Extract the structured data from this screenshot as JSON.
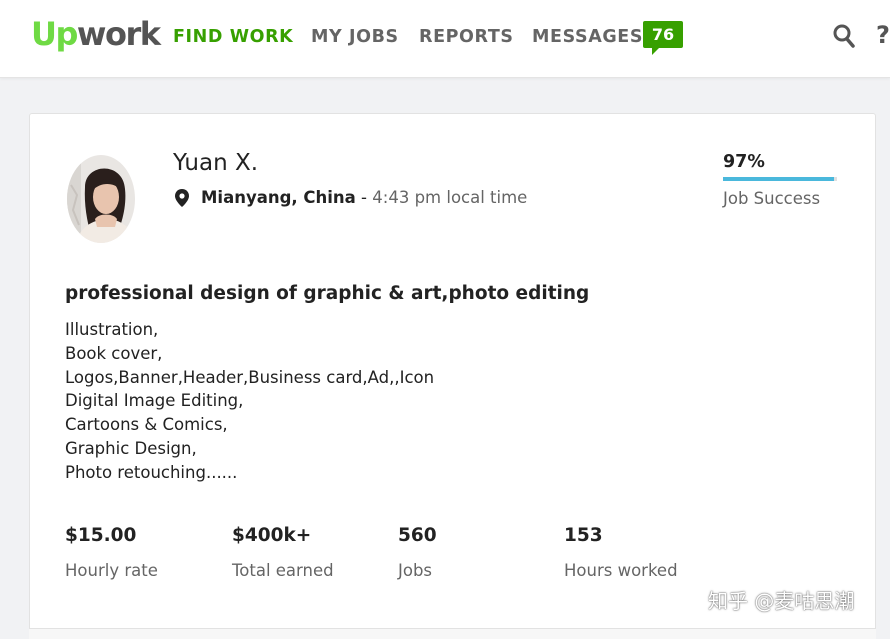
{
  "header": {
    "logo": {
      "up": "Up",
      "work": "work"
    },
    "nav": [
      {
        "label": "FIND WORK",
        "active": true
      },
      {
        "label": "MY JOBS",
        "active": false
      },
      {
        "label": "REPORTS",
        "active": false
      },
      {
        "label": "MESSAGES",
        "active": false
      }
    ],
    "messages_count": "76",
    "search_icon": "search-icon",
    "help_label": "?"
  },
  "profile": {
    "name": "Yuan X.",
    "location_city": "Mianyang, China",
    "location_separator": " - ",
    "local_time": "4:43 pm local time",
    "job_success": {
      "percent_label": "97%",
      "value": 0.97,
      "label": "Job Success"
    },
    "headline": "professional design of graphic & art,photo editing",
    "description_lines": [
      "Illustration,",
      "Book cover,",
      "Logos,Banner,Header,Business card,Ad,,Icon",
      "Digital Image Editing,",
      "Cartoons & Comics,",
      "Graphic Design,",
      "Photo retouching......"
    ],
    "stats": [
      {
        "value": "$15.00",
        "label": "Hourly rate"
      },
      {
        "value": "$400k+",
        "label": "Total earned"
      },
      {
        "value": "560",
        "label": "Jobs"
      },
      {
        "value": "153",
        "label": "Hours worked"
      }
    ]
  },
  "watermark": "知乎 @麦咕思潮",
  "colors": {
    "brand_green": "#6fda44",
    "active_green": "#37a000",
    "progress_blue": "#4ab8dc",
    "muted_text": "#656565"
  }
}
